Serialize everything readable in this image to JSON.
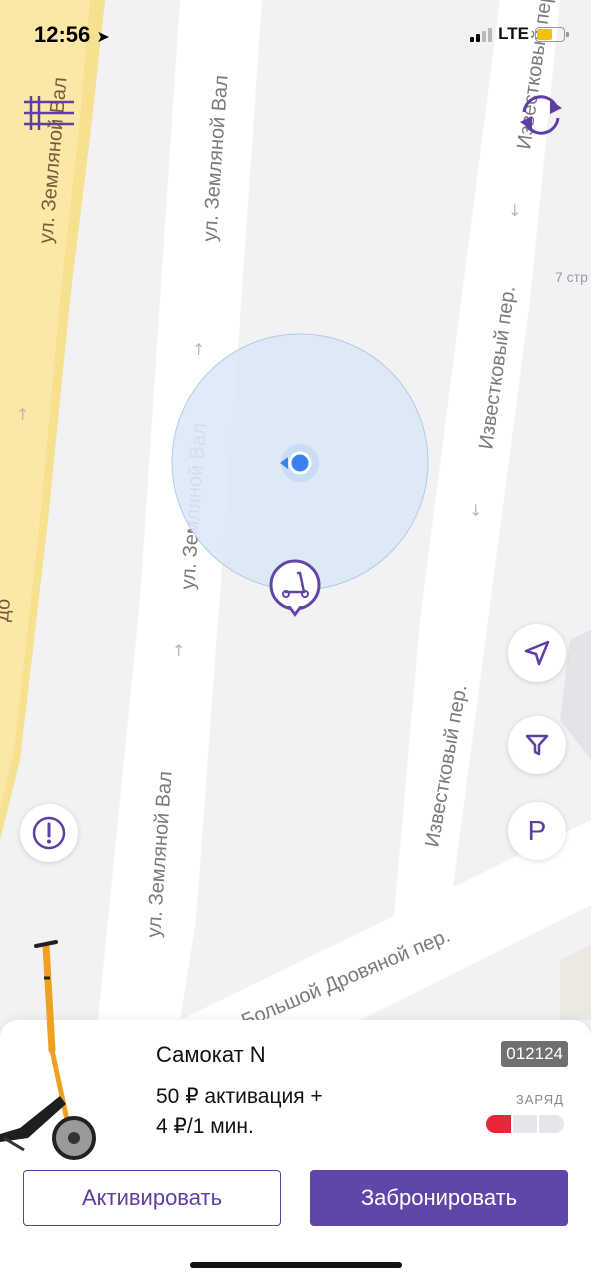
{
  "status_bar": {
    "time": "12:56",
    "network": "LTE"
  },
  "colors": {
    "accent": "#6046a8",
    "road_main": "#fbe8a6",
    "user_dot": "#3b82f0",
    "charge_low": "#e8263a"
  },
  "map": {
    "street_labels": {
      "zemlyanoy_left": "ул. Земляной Вал",
      "zemlyanoy_top": "ул. Земляной Вал",
      "zemlyanoy_mid": "ул. Земляной Вал",
      "zemlyanoy_bottom": "ул. Земляной Вал",
      "izvestkoviy_top": "Известковый пер.",
      "izvestkoviy_mid": "Известковый пер.",
      "izvestkoviy_bottom": "Известковый пер.",
      "drovyanoy": "Большой Дровяной пер.",
      "building": "7 стр",
      "edge_fragment": "до"
    },
    "icons": {
      "menu": "menu-icon",
      "refresh": "refresh-icon",
      "locate": "navigation-arrow-icon",
      "filter": "filter-icon",
      "alert": "alert-icon",
      "scooter_pin": "scooter-pin-icon"
    },
    "parking_label": "P"
  },
  "vehicle": {
    "title": "Самокат N",
    "code": "012124",
    "price_line1": "50 ₽ активация +",
    "price_line2": "4 ₽/1 мин.",
    "charge_label": "ЗАРЯД",
    "charge_level": 0.33
  },
  "actions": {
    "activate": "Активировать",
    "reserve": "Забронировать"
  }
}
